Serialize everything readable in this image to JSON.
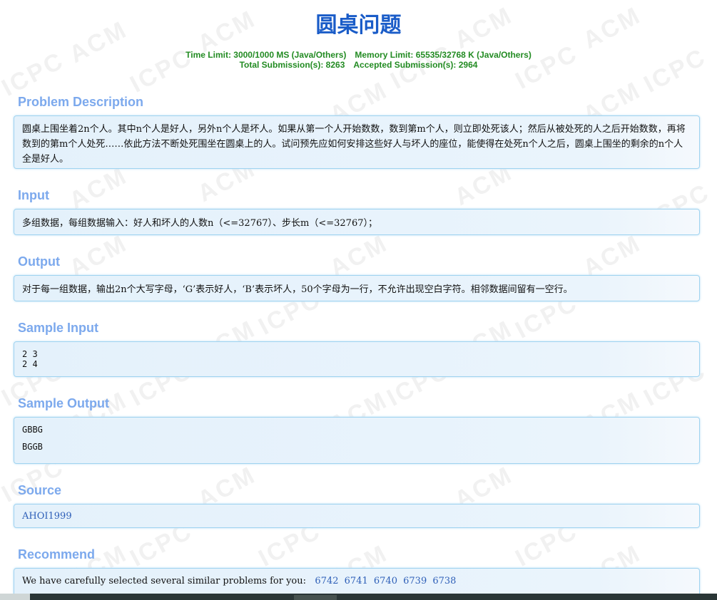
{
  "problem": {
    "title": "圆桌问题",
    "time_limit": "Time Limit: 3000/1000 MS (Java/Others)",
    "memory_limit": "Memory Limit: 65535/32768 K (Java/Others)",
    "total_submissions": "Total Submission(s): 8263",
    "accepted_submissions": "Accepted Submission(s): 2964"
  },
  "sections": {
    "description": {
      "heading": "Problem Description",
      "text": "圆桌上围坐着2n个人。其中n个人是好人，另外n个人是坏人。如果从第一个人开始数数，数到第m个人，则立即处死该人；然后从被处死的人之后开始数数，再将数到的第m个人处死……依此方法不断处死围坐在圆桌上的人。试问预先应如何安排这些好人与坏人的座位，能使得在处死n个人之后，圆桌上围坐的剩余的n个人全是好人。"
    },
    "input": {
      "heading": "Input",
      "text": "多组数据，每组数据输入：好人和坏人的人数n（<=32767）、步长m（<=32767）；"
    },
    "output": {
      "heading": "Output",
      "text": "对于每一组数据，输出2n个大写字母，‘G’表示好人，‘B’表示坏人，50个字母为一行，不允许出现空白字符。相邻数据间留有一空行。"
    },
    "sample_input": {
      "heading": "Sample Input",
      "text": "2 3\n2 4"
    },
    "sample_output": {
      "heading": "Sample Output",
      "text": "GBBG\n\nBGGB"
    },
    "source": {
      "heading": "Source",
      "text": "AHOI1999"
    },
    "recommend": {
      "heading": "Recommend",
      "text": "We have carefully selected several similar problems for you:",
      "links": [
        "6742",
        "6741",
        "6740",
        "6739",
        "6738"
      ]
    }
  },
  "watermark": {
    "text": [
      "ACM",
      "ICPC"
    ]
  },
  "colors": {
    "title": "#1a5cc8",
    "meta": "#228b22",
    "section_heading": "#7ca9ed",
    "panel_border": "#9fd3f0",
    "link": "#2e5fb8"
  }
}
